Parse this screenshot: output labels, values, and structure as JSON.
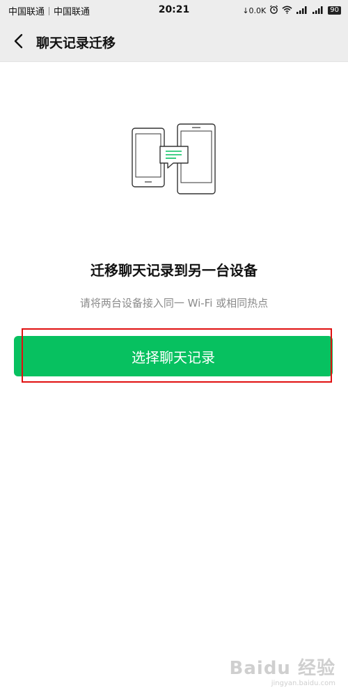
{
  "status_bar": {
    "carrier1": "中国联通",
    "carrier2": "中国联通",
    "time": "20:21",
    "speed": "0.0K",
    "battery": "90"
  },
  "header": {
    "title": "聊天记录迁移"
  },
  "main": {
    "headline": "迁移聊天记录到另一台设备",
    "subline": "请将两台设备接入同一 Wi-Fi 或相同热点",
    "button_label": "选择聊天记录"
  },
  "watermark": {
    "top": "Baidu 经验",
    "bottom": "jingyan.baidu.com"
  },
  "colors": {
    "accent": "#07c160",
    "highlight": "#e01010",
    "header_bg": "#ededed"
  }
}
